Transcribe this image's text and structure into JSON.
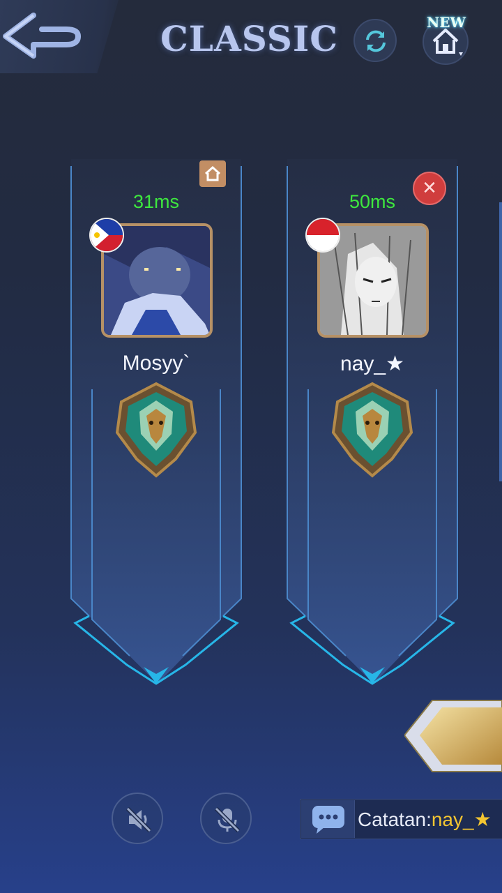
{
  "header": {
    "title": "CLASSIC",
    "new_badge": "NEW",
    "back_icon": "back-arrow-icon",
    "refresh_icon": "refresh-icon",
    "home_icon": "home-icon"
  },
  "players": [
    {
      "ping": "31ms",
      "name": "Mosyy`",
      "flag": "philippines-flag-icon",
      "role_icon": "host-house-icon",
      "rank_icon": "mythic-rank-emblem-icon"
    },
    {
      "ping": "50ms",
      "name": "nay_★",
      "flag": "indonesia-flag-icon",
      "role_icon": "kick-close-icon",
      "rank_icon": "mythic-rank-emblem-icon"
    }
  ],
  "bottom": {
    "speaker_icon": "speaker-muted-icon",
    "mic_icon": "mic-muted-icon",
    "chat_label": "Catatan:",
    "chat_author": "nay_★"
  },
  "colors": {
    "ping": "#3ee83e",
    "frame_border": "#4a86c8",
    "accent_cyan": "#27b6e8",
    "gold": "#c9a45a",
    "chat_name": "#f3c531"
  }
}
